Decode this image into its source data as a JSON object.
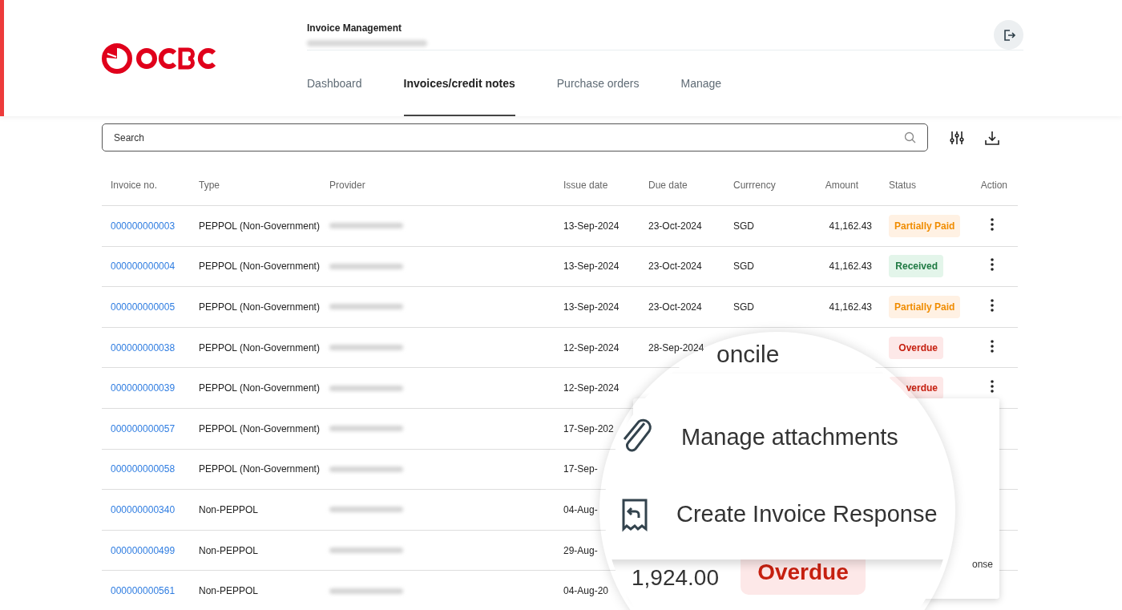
{
  "header": {
    "title": "Invoice Management",
    "tabs": [
      {
        "label": "Dashboard",
        "selected": false
      },
      {
        "label": "Invoices/credit notes",
        "selected": true
      },
      {
        "label": "Purchase orders",
        "selected": false
      },
      {
        "label": "Manage",
        "selected": false
      }
    ]
  },
  "search": {
    "placeholder": "Search"
  },
  "table": {
    "columns": [
      "Invoice no.",
      "Type",
      "Provider",
      "Issue date",
      "Due date",
      "Currrency",
      "Amount",
      "Status",
      "Action"
    ],
    "rows": [
      {
        "invoice_no": "000000000003",
        "type": "PEPPOL (Non-Government)",
        "issue_date": "13-Sep-2024",
        "due_date": "23-Oct-2024",
        "currency": "SGD",
        "amount": "41,162.43",
        "status": {
          "label": "Partially Paid",
          "kind": "partial"
        },
        "has_action": true
      },
      {
        "invoice_no": "000000000004",
        "type": "PEPPOL (Non-Government)",
        "issue_date": "13-Sep-2024",
        "due_date": "23-Oct-2024",
        "currency": "SGD",
        "amount": "41,162.43",
        "status": {
          "label": "Received",
          "kind": "received"
        },
        "has_action": true
      },
      {
        "invoice_no": "000000000005",
        "type": "PEPPOL (Non-Government)",
        "issue_date": "13-Sep-2024",
        "due_date": "23-Oct-2024",
        "currency": "SGD",
        "amount": "41,162.43",
        "status": {
          "label": "Partially Paid",
          "kind": "partial"
        },
        "has_action": true
      },
      {
        "invoice_no": "000000000038",
        "type": "PEPPOL (Non-Government)",
        "issue_date": "12-Sep-2024",
        "due_date": "28-Sep-2024",
        "status": {
          "label": "Overdue",
          "kind": "overdue"
        },
        "has_action": true
      },
      {
        "invoice_no": "000000000039",
        "type": "PEPPOL (Non-Government)",
        "issue_date": "12-Sep-2024",
        "status": {
          "label": "verdue",
          "kind": "overdue"
        },
        "has_action": true
      },
      {
        "invoice_no": "000000000057",
        "type": "PEPPOL (Non-Government)",
        "issue_date": "17-Sep-202"
      },
      {
        "invoice_no": "000000000058",
        "type": "PEPPOL (Non-Government)",
        "issue_date": "17-Sep-"
      },
      {
        "invoice_no": "000000000340",
        "type": "Non-PEPPOL",
        "issue_date": "04-Aug-"
      },
      {
        "invoice_no": "000000000499",
        "type": "Non-PEPPOL",
        "issue_date": "29-Aug-"
      },
      {
        "invoice_no": "000000000561",
        "type": "Non-PEPPOL",
        "issue_date": "04-Aug-20"
      }
    ]
  },
  "action_menu": {
    "partial_text": "onse"
  },
  "magnifier": {
    "top_text": "oncile",
    "items": [
      {
        "label": "Manage attachments",
        "kind": "attachment"
      },
      {
        "label": "Create Invoice Response",
        "kind": "response"
      }
    ],
    "amount": "1,924.00",
    "status": {
      "label": "Overdue",
      "kind": "overdue"
    }
  }
}
